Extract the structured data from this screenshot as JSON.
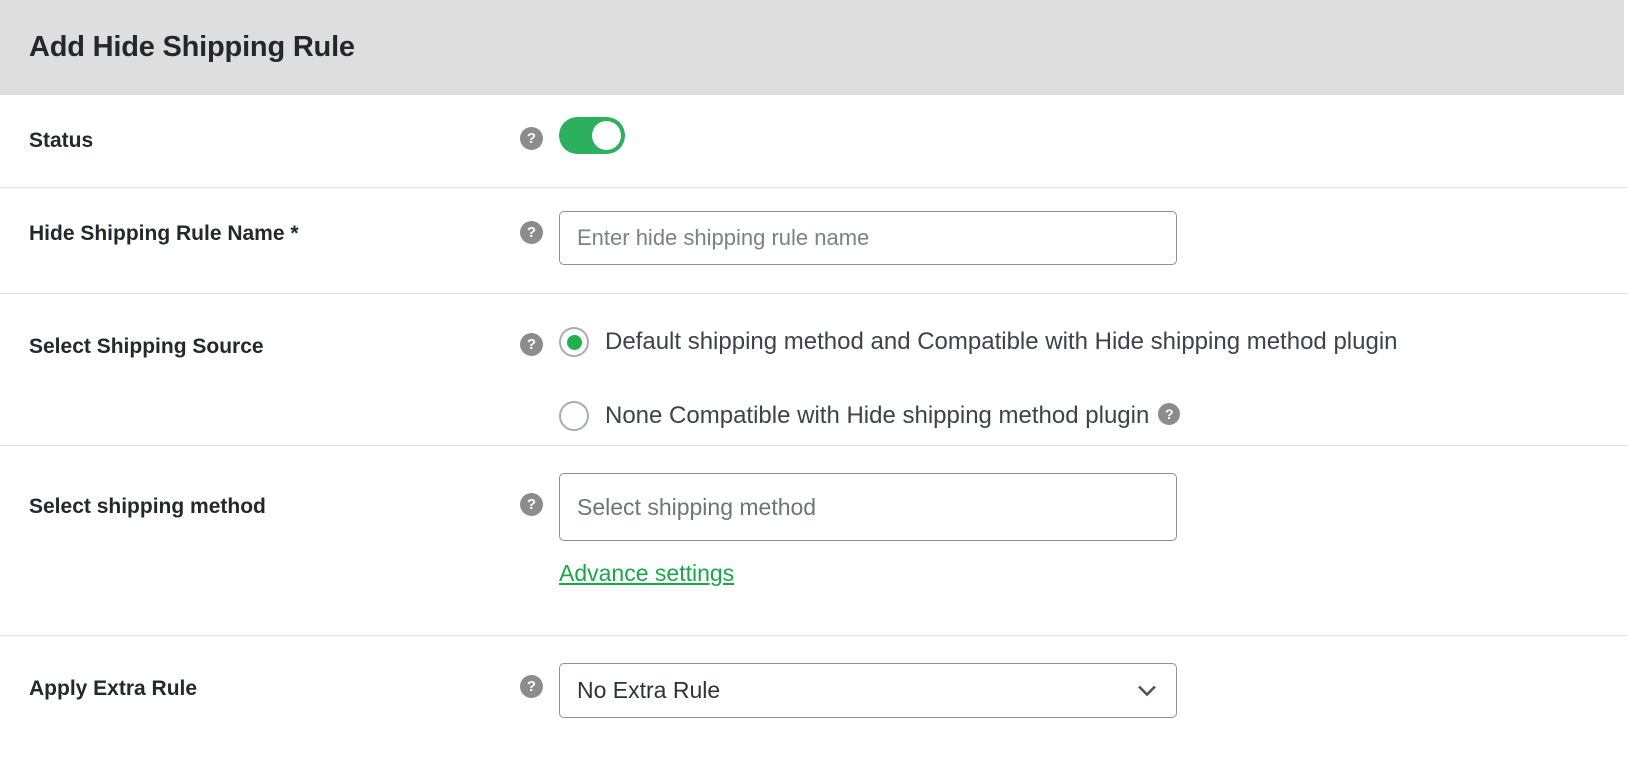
{
  "header": {
    "title": "Add Hide Shipping Rule",
    "background_color": "#dedede"
  },
  "colors": {
    "accent_green": "#21b14c",
    "toggle_on": "#2cb05e",
    "link_green": "#19a74a",
    "help_icon_gray": "#8c8c8c",
    "border_gray": "#8f8f98",
    "row_divider": "#e2e2e2",
    "label_text": "#23282d"
  },
  "icons": {
    "help": "?",
    "chevron_down": "chevron-down-icon"
  },
  "rows": {
    "status": {
      "label": "Status",
      "help_icon": "help-icon",
      "toggle": {
        "name": "status-toggle",
        "state": "on"
      }
    },
    "rule_name": {
      "label": "Hide Shipping Rule Name *",
      "help_icon": "help-icon",
      "input": {
        "value": "",
        "placeholder": "Enter hide shipping rule name"
      }
    },
    "shipping_source": {
      "label": "Select Shipping Source",
      "help_icon": "help-icon",
      "options": [
        {
          "label": "Default shipping method and Compatible with Hide shipping method plugin",
          "selected": true,
          "has_help_icon": false
        },
        {
          "label": "None Compatible with Hide shipping method plugin",
          "selected": false,
          "has_help_icon": true
        }
      ]
    },
    "shipping_method": {
      "label": "Select shipping method",
      "help_icon": "help-icon",
      "select": {
        "value": "",
        "placeholder": "Select shipping method"
      },
      "advance_link": "Advance settings"
    },
    "extra_rule": {
      "label": "Apply Extra Rule",
      "help_icon": "help-icon",
      "select": {
        "value": "No Extra Rule",
        "options": [
          "No Extra Rule"
        ]
      }
    }
  }
}
